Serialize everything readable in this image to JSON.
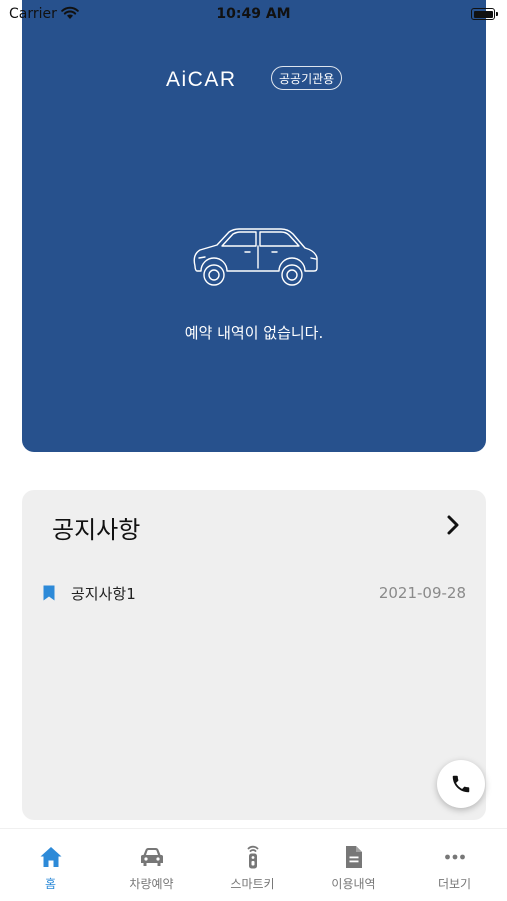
{
  "status_bar": {
    "carrier": "Carrier",
    "time": "10:49 AM"
  },
  "brand": {
    "logo": "AiCAR",
    "badge": "공공기관용"
  },
  "hero": {
    "empty_message": "예약 내역이 없습니다."
  },
  "notice": {
    "title": "공지사항",
    "items": [
      {
        "title": "공지사항1",
        "date": "2021-09-28"
      }
    ]
  },
  "tabs": [
    {
      "label": "홈",
      "icon": "home-icon",
      "active": true
    },
    {
      "label": "차량예약",
      "icon": "car-icon",
      "active": false
    },
    {
      "label": "스마트키",
      "icon": "smart-key-icon",
      "active": false
    },
    {
      "label": "이용내역",
      "icon": "document-icon",
      "active": false
    },
    {
      "label": "더보기",
      "icon": "more-icon",
      "active": false
    }
  ],
  "colors": {
    "hero_bg": "#27518d",
    "accent": "#2d8ad8",
    "card_bg": "#efefef"
  }
}
